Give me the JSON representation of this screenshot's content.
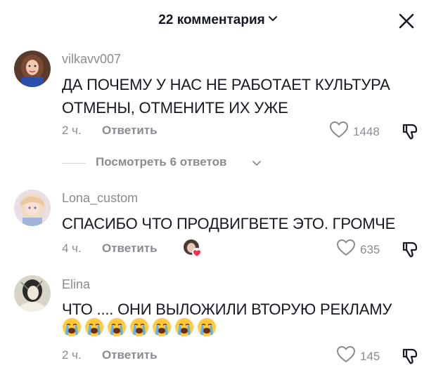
{
  "header": {
    "title": "22 комментария",
    "close_icon": "close-icon",
    "chevron_icon": "chevron-down-icon"
  },
  "comments": [
    {
      "username": "vilkavv007",
      "text": "ДА ПОЧЕМУ У НАС НЕ РАБОТАЕТ КУЛЬТУРА ОТМЕНЫ, ОТМЕНИТЕ ИХ УЖЕ",
      "time": "2 ч.",
      "reply_label": "Ответить",
      "likes": "1448",
      "view_replies": "Посмотреть 6 ответов"
    },
    {
      "username": "Lona_custom",
      "text": "СПАСИБО ЧТО ПРОДВИГВЕТЕ ЭТО. ГРОМЧЕ",
      "time": "4 ч.",
      "reply_label": "Ответить",
      "likes": "635",
      "creator_liked": true
    },
    {
      "username": "Elina",
      "text": "ЧТО .... ОНИ ВЫЛОЖИЛИ ВТОРУЮ РЕКЛАМУ",
      "emojis": [
        "crying-face",
        "crying-face",
        "crying-face",
        "crying-face",
        "crying-face",
        "crying-face",
        "crying-face"
      ],
      "time": "2 ч.",
      "reply_label": "Ответить",
      "likes": "145"
    }
  ],
  "colors": {
    "text_primary": "#161823",
    "text_secondary": "#8a8b91",
    "heart_red": "#fe2c55"
  }
}
